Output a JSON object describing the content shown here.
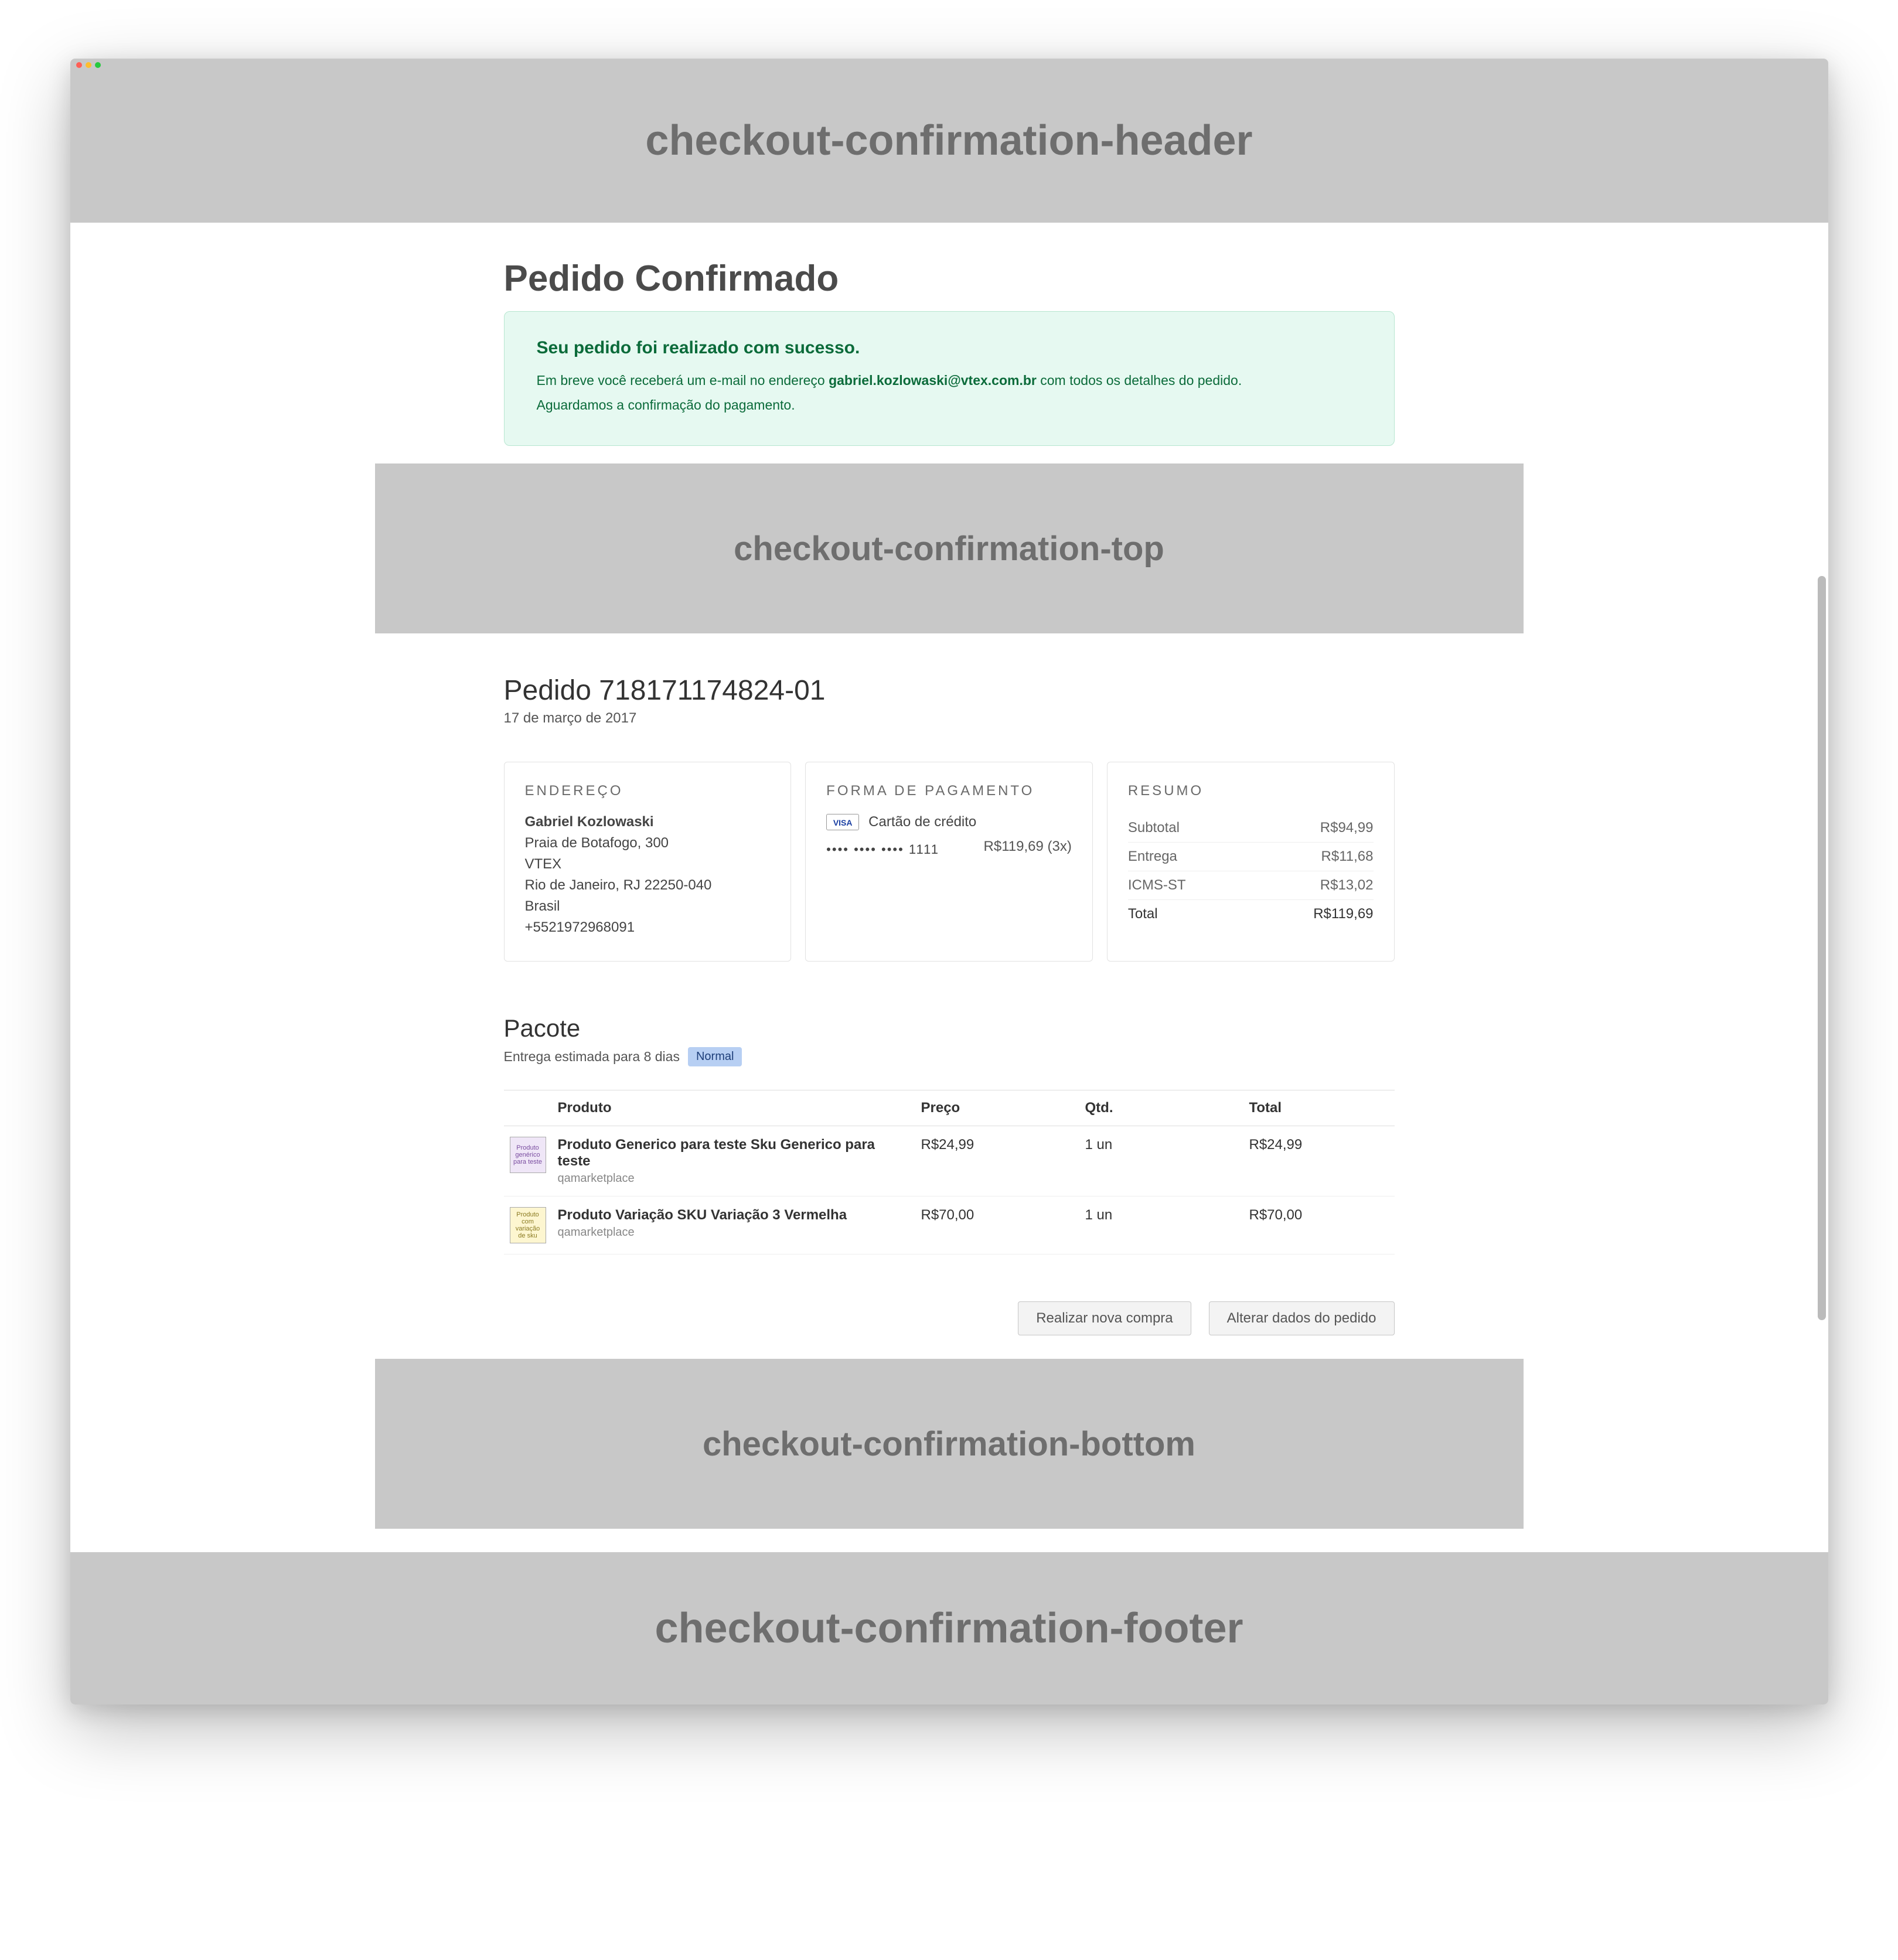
{
  "placeholders": {
    "header": "checkout-confirmation-header",
    "top": "checkout-confirmation-top",
    "bottom": "checkout-confirmation-bottom",
    "footer": "checkout-confirmation-footer"
  },
  "title": "Pedido Confirmado",
  "success": {
    "headline": "Seu pedido foi realizado com sucesso.",
    "line1_prefix": "Em breve você receberá um e-mail no endereço ",
    "email": "gabriel.kozlowaski@vtex.com.br",
    "line1_suffix": " com todos os detalhes do pedido.",
    "line2": "Aguardamos a confirmação do pagamento."
  },
  "order": {
    "heading": "Pedido 718171174824-01",
    "date": "17 de março de 2017"
  },
  "address": {
    "title": "ENDEREÇO",
    "name": "Gabriel Kozlowaski",
    "street": "Praia de Botafogo, 300",
    "company": "VTEX",
    "city_line": "Rio de Janeiro, RJ 22250-040",
    "country": "Brasil",
    "phone": "+5521972968091"
  },
  "payment": {
    "title": "FORMA DE PAGAMENTO",
    "brand": "VISA",
    "method": "Cartão de crédito",
    "masked": "•••• •••• •••• 1111",
    "amount": "R$119,69 (3x)"
  },
  "summary": {
    "title": "RESUMO",
    "rows": [
      {
        "label": "Subtotal",
        "value": "R$94,99"
      },
      {
        "label": "Entrega",
        "value": "R$11,68"
      },
      {
        "label": "ICMS-ST",
        "value": "R$13,02"
      }
    ],
    "total_label": "Total",
    "total_value": "R$119,69"
  },
  "package": {
    "title": "Pacote",
    "est_label": "Entrega estimada para 8 dias",
    "badge": "Normal",
    "columns": {
      "product": "Produto",
      "price": "Preço",
      "qty": "Qtd.",
      "total": "Total"
    },
    "items": [
      {
        "thumb_text": "Produto genérico para teste",
        "thumb_class": "purple",
        "name": "Produto Generico para teste Sku Generico para teste",
        "shop": "qamarketplace",
        "price": "R$24,99",
        "qty": "1 un",
        "total": "R$24,99"
      },
      {
        "thumb_text": "Produto com variação de sku",
        "thumb_class": "yellow",
        "name": "Produto Variação SKU Variação 3 Vermelha",
        "shop": "qamarketplace",
        "price": "R$70,00",
        "qty": "1 un",
        "total": "R$70,00"
      }
    ]
  },
  "actions": {
    "new_purchase": "Realizar nova compra",
    "edit_order": "Alterar dados do pedido"
  }
}
